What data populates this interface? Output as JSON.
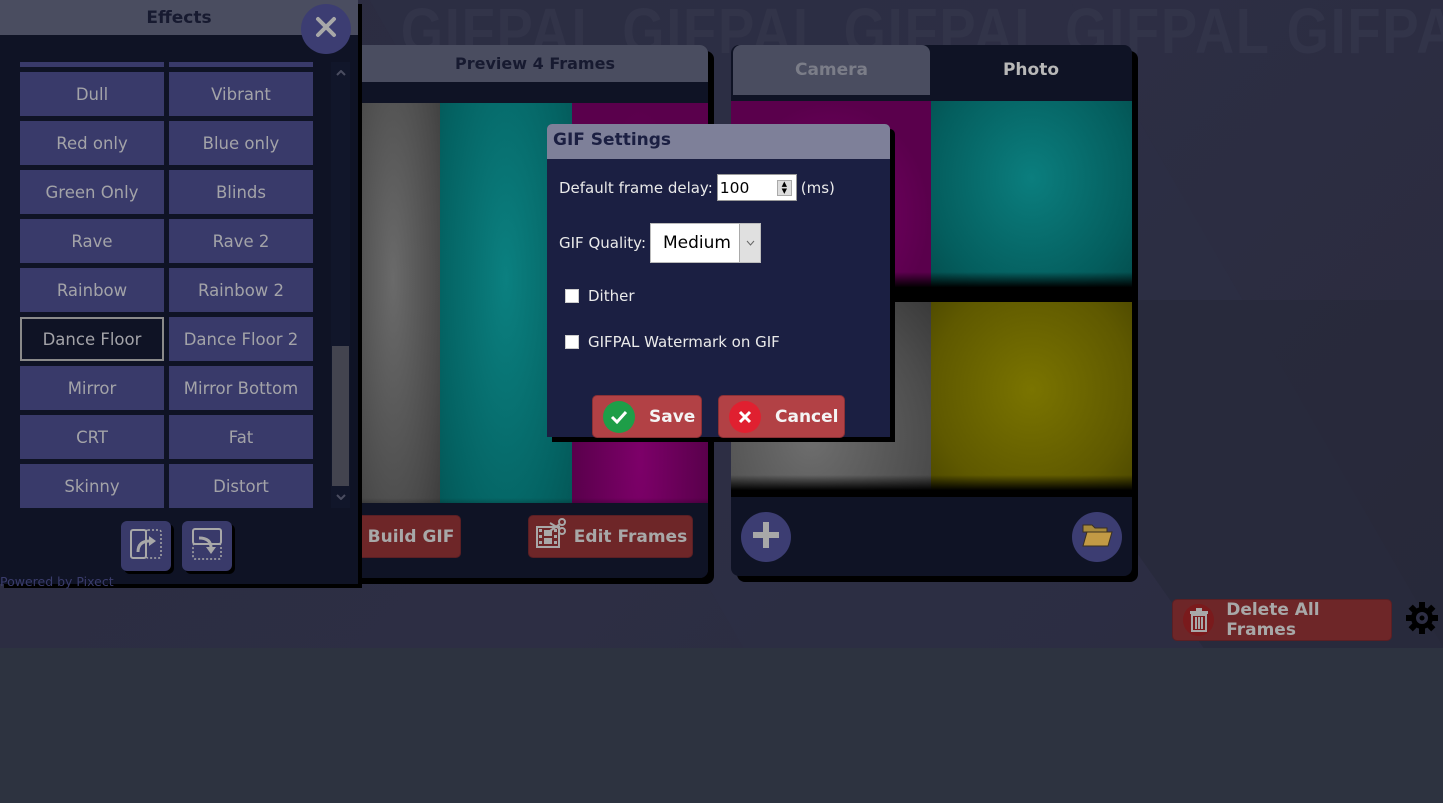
{
  "background": {
    "watermark_text": "L GIFPAL GIFPAL GIFPAL GIFPAL GIFPAL GIF"
  },
  "effects_panel": {
    "title": "Effects",
    "close_label": "close",
    "effects": [
      {
        "label": "",
        "selected": false
      },
      {
        "label": "",
        "selected": false
      },
      {
        "label": "Dull",
        "selected": false
      },
      {
        "label": "Vibrant",
        "selected": false
      },
      {
        "label": "Red only",
        "selected": false
      },
      {
        "label": "Blue only",
        "selected": false
      },
      {
        "label": "Green Only",
        "selected": false
      },
      {
        "label": "Blinds",
        "selected": false
      },
      {
        "label": "Rave",
        "selected": false
      },
      {
        "label": "Rave 2",
        "selected": false
      },
      {
        "label": "Rainbow",
        "selected": false
      },
      {
        "label": "Rainbow 2",
        "selected": false
      },
      {
        "label": "Dance Floor",
        "selected": true
      },
      {
        "label": "Dance Floor 2",
        "selected": false
      },
      {
        "label": "Mirror",
        "selected": false
      },
      {
        "label": "Mirror Bottom",
        "selected": false
      },
      {
        "label": "CRT",
        "selected": false
      },
      {
        "label": "Fat",
        "selected": false
      },
      {
        "label": "Skinny",
        "selected": false
      },
      {
        "label": "Distort",
        "selected": false
      }
    ],
    "footer": "Powered by Pixect"
  },
  "preview_panel": {
    "tab_label": "Preview 4 Frames",
    "build_label": "Build GIF",
    "edit_label": "Edit Frames"
  },
  "capture_panel": {
    "tabs": [
      {
        "label": "Camera",
        "active": false
      },
      {
        "label": "Photo",
        "active": true
      }
    ]
  },
  "delete_all_label": "Delete All Frames",
  "dialog": {
    "title": "GIF Settings",
    "delay_label": "Default frame delay:",
    "delay_value": "100",
    "delay_unit": "(ms)",
    "quality_label": "GIF Quality:",
    "quality_value": "Medium",
    "dither_label": "Dither",
    "dither_checked": false,
    "watermark_label": "GIFPAL Watermark on GIF",
    "watermark_checked": false,
    "save_label": "Save",
    "cancel_label": "Cancel"
  },
  "colors": {
    "panel_bg": "#0f1325",
    "effect_button": "#393a6a",
    "action_red": "#6e2628",
    "dialog_button_red": "#b24145",
    "dialog_bg": "#1b1f42",
    "dialog_title": "#7e8099"
  }
}
